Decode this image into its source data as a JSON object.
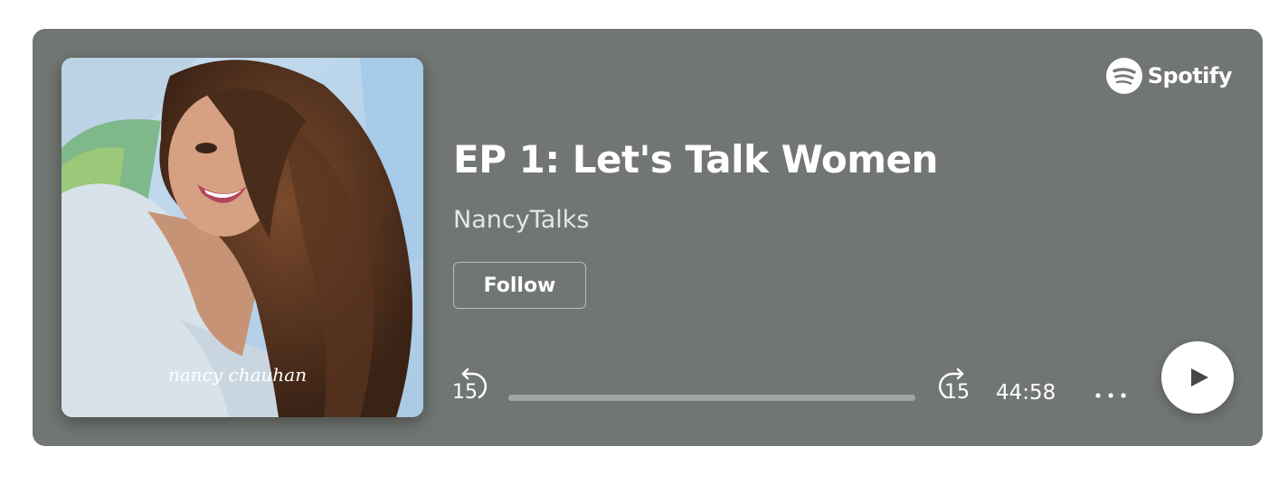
{
  "brand": {
    "name": "Spotify",
    "icon": "spotify-logo-icon"
  },
  "episode": {
    "title": "EP 1: Let's Talk Women",
    "show": "NancyTalks",
    "cover_signature": "nancy chauhan"
  },
  "actions": {
    "follow_label": "Follow"
  },
  "player": {
    "skip_back_seconds": "15",
    "skip_forward_seconds": "15",
    "duration": "44:58",
    "progress": 0,
    "more_icon": "more-options-icon",
    "play_icon": "play-icon"
  },
  "colors": {
    "background": "#727672",
    "text": "#ffffff",
    "show_text": "#e4e6e4",
    "progress_track": "#a3a6a3"
  }
}
